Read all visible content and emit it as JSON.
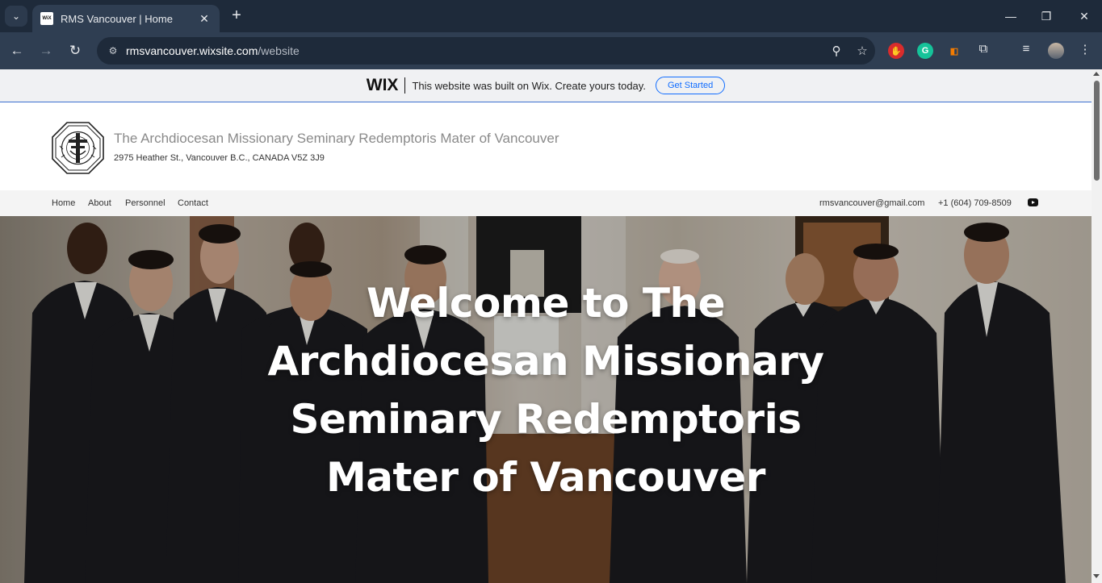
{
  "browser": {
    "tab_title": "RMS Vancouver | Home",
    "favicon_text": "WiX",
    "url_host": "rmsvancouver.wixsite.com",
    "url_path": "/website"
  },
  "wix_banner": {
    "logo": "WIX",
    "text": "This website was built on Wix. Create yours today.",
    "button": "Get Started"
  },
  "site": {
    "title": "The Archdiocesan Missionary Seminary Redemptoris Mater of Vancouver",
    "address": "2975 Heather St., Vancouver B.C., CANADA V5Z 3J9"
  },
  "nav": {
    "items": [
      "Home",
      "About",
      "Personnel",
      "Contact"
    ],
    "email": "rmsvancouver@gmail.com",
    "phone": "+1 (604) 709-8509"
  },
  "hero": {
    "title": "Welcome to The Archdiocesan Missionary Seminary Redemptoris Mater of Vancouver"
  },
  "colors": {
    "chrome_dark": "#1e2a3a",
    "chrome_toolbar": "#2f3e52",
    "wix_blue": "#116dff"
  }
}
